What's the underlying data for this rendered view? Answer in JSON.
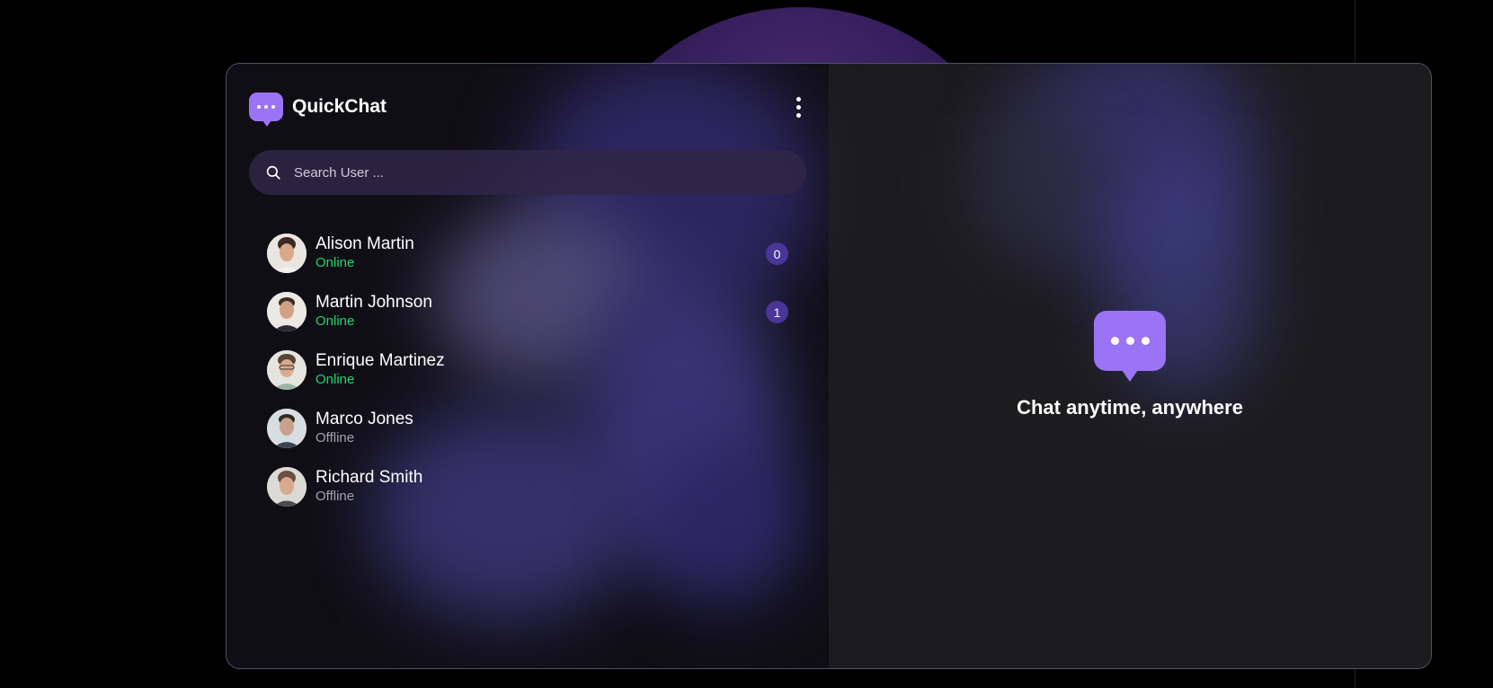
{
  "app": {
    "title": "QuickChat",
    "logo_icon": "chat-bubble-icon",
    "menu_icon": "more-vertical-icon",
    "accent_color": "#9b73f5"
  },
  "search": {
    "placeholder": "Search User ...",
    "value": ""
  },
  "users": [
    {
      "name": "Alison Martin",
      "status": "Online",
      "unread": "0"
    },
    {
      "name": "Martin Johnson",
      "status": "Online",
      "unread": "1"
    },
    {
      "name": "Enrique Martinez",
      "status": "Online",
      "unread": null
    },
    {
      "name": "Marco Jones",
      "status": "Offline",
      "unread": null
    },
    {
      "name": "Richard Smith",
      "status": "Offline",
      "unread": null
    }
  ],
  "empty_state": {
    "icon": "chat-bubble-icon",
    "message": "Chat anytime, anywhere"
  },
  "colors": {
    "online": "#22d36b",
    "offline": "#a3a3ad",
    "badge": "#4a3598"
  }
}
